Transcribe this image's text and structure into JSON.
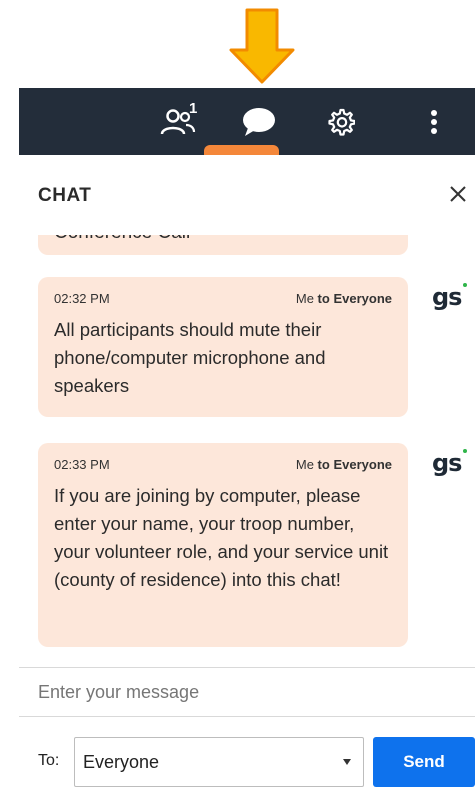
{
  "toolbar": {
    "participants_count": "1",
    "icons": [
      "participants-icon",
      "chat-icon",
      "settings-icon",
      "more-vertical-icon"
    ],
    "active_color": "#f4873a",
    "bg_color": "#232d3a"
  },
  "chat": {
    "title": "CHAT",
    "messages": [
      {
        "text": "Conference Call"
      },
      {
        "time": "02:32 PM",
        "sender": "Me",
        "to_prefix": "to",
        "recipient": "Everyone",
        "avatar": "gs",
        "text": "All participants should mute their phone/computer microphone and speakers"
      },
      {
        "time": "02:33 PM",
        "sender": "Me",
        "to_prefix": "to",
        "recipient": "Everyone",
        "avatar": "gs",
        "text": "If you are joining by computer, please enter your name, your troop number, your volunteer role, and your service unit (county of residence) into this chat!"
      }
    ],
    "bubble_color": "#fde7da"
  },
  "composer": {
    "placeholder": "Enter your message",
    "to_label": "To:",
    "to_selected": "Everyone",
    "send_label": "Send",
    "send_color": "#0e72ed"
  }
}
